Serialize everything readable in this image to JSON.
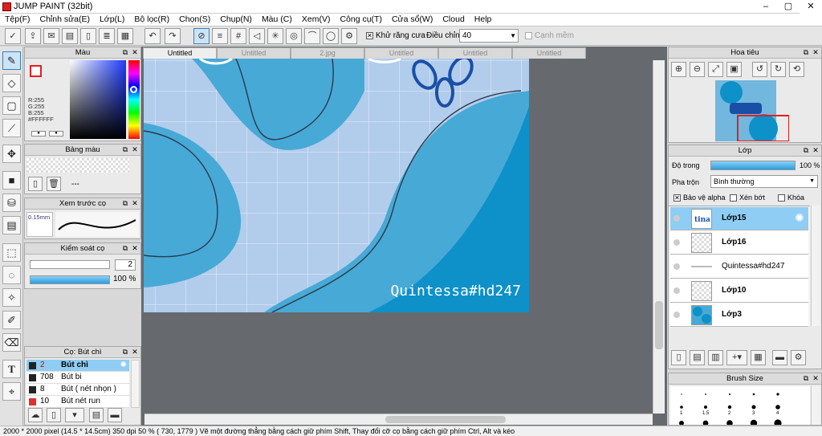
{
  "window": {
    "title": "JUMP PAINT (32bit)",
    "min": "–",
    "max": "▢",
    "close": "✕"
  },
  "menu": [
    "Tệp(F)",
    "Chỉnh sửa(E)",
    "Lớp(L)",
    "Bộ lọc(R)",
    "Chọn(S)",
    "Chụp(N)",
    "Màu (C)",
    "Xem(V)",
    "Công cụ(T)",
    "Cửa sổ(W)",
    "Cloud",
    "Help"
  ],
  "toolbar": {
    "antialias_label": "Khử răng cưa",
    "adjust_label": "Điều chỉnh",
    "adjust_value": "40",
    "edge_label": "Cạnh mềm"
  },
  "tabs": [
    "Untitled",
    "Untitled",
    "2.jpg",
    "Untitled",
    "Untitled",
    "Untitled"
  ],
  "color_panel": {
    "title": "Màu",
    "r": "R:255",
    "g": "G:255",
    "b": "B:255",
    "hex": "#FFFFFF",
    "fg": "#ffffff",
    "bg": "#ffffff"
  },
  "palette_panel": {
    "title": "Bảng màu",
    "value": "---"
  },
  "brush_preview": {
    "title": "Xem trước cọ",
    "size": "0.15mm"
  },
  "brush_control": {
    "title": "Kiểm soát cọ",
    "size": "2",
    "opacity": "100 %",
    "opacity_fraction": 1.0
  },
  "brush_list": {
    "title": "Cọ: Bút chì",
    "items": [
      {
        "num": "2",
        "name": "Bút chì",
        "color": "#222222",
        "selected": true
      },
      {
        "num": "708",
        "name": "Bút bi",
        "color": "#222222",
        "selected": false
      },
      {
        "num": "8",
        "name": "Bút ( nét nhọn )",
        "color": "#222222",
        "selected": false
      },
      {
        "num": "10",
        "name": "Bút nét run",
        "color": "#e03030",
        "selected": false
      }
    ]
  },
  "navigator": {
    "title": "Hoa tiêu"
  },
  "layers": {
    "title": "Lớp",
    "opacity_label": "Độ trong",
    "opacity_value": "100 %",
    "opacity_fraction": 1.0,
    "blend_label": "Pha trộn",
    "blend_value": "Bình thường",
    "protect_alpha": "Bảo vệ alpha",
    "clip": "Xén bớt",
    "lock": "Khóa",
    "items": [
      "Lớp15",
      "Lớp16",
      "Quintessa#hd247",
      "Lớp10",
      "Lớp3"
    ]
  },
  "brush_size": {
    "title": "Brush Size",
    "labels": [
      "1",
      "1.5",
      "2",
      "3",
      "4"
    ]
  },
  "artwork": {
    "watermark": "Quintessa#hd247",
    "colors": {
      "bg": "#b2ccec",
      "mid": "#47a9d6",
      "deep": "#0e90c8",
      "dark": "#1a4fa6"
    }
  },
  "status": {
    "text": "2000 * 2000 pixel  (14.5 * 14.5cm)  350 dpi   50 %   ( 730, 1779 )   Vẽ một đường thẳng bằng cách giữ phím Shift, Thay đổi cỡ cọ bằng cách giữ phím Ctrl, Alt và kéo"
  }
}
